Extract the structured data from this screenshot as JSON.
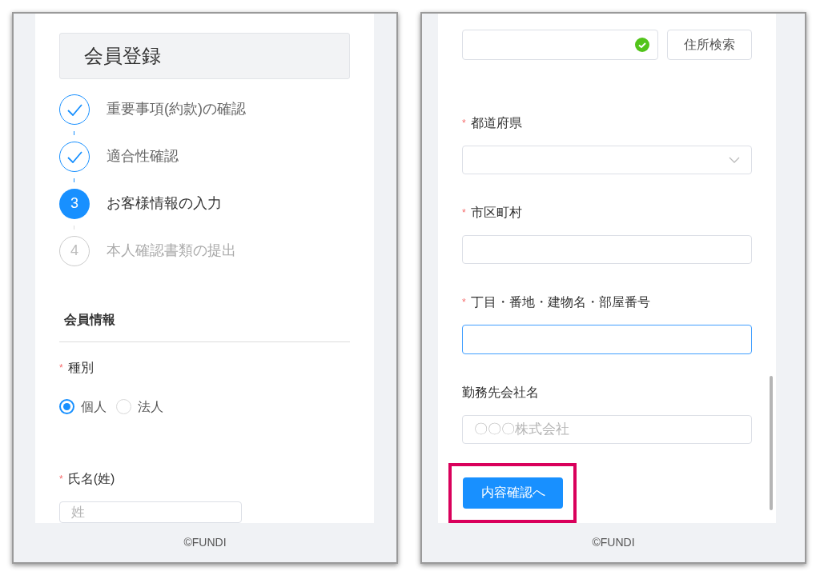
{
  "screens": [
    {
      "title": "会員登録",
      "steps": [
        {
          "label": "重要事項(約款)の確認",
          "kind": "done"
        },
        {
          "label": "適合性確認",
          "kind": "done"
        },
        {
          "number": "3",
          "label": "お客様情報の入力",
          "kind": "current"
        },
        {
          "number": "4",
          "label": "本人確認書類の提出",
          "kind": "pending"
        }
      ],
      "section_title": "会員情報",
      "fields": [
        {
          "kind": "radio",
          "label": "種別",
          "required_mark": "*",
          "options": [
            {
              "label": "個人",
              "selected": true
            },
            {
              "label": "法人",
              "selected": false
            }
          ]
        },
        {
          "kind": "text",
          "label": "氏名(姓)",
          "required_mark": "*",
          "placeholder": "姓",
          "short": true
        }
      ],
      "footer": "©FUNDI"
    },
    {
      "fields": [
        {
          "kind": "search",
          "valid": true,
          "button": "住所検索"
        },
        {
          "kind": "select",
          "label": "都道府県",
          "required_mark": "*"
        },
        {
          "kind": "text",
          "label": "市区町村",
          "required_mark": "*"
        },
        {
          "kind": "text",
          "label": "丁目・番地・建物名・部屋番号",
          "required_mark": "*",
          "focused": true
        },
        {
          "kind": "text",
          "label": "勤務先会社名",
          "placeholder": "〇〇〇株式会社"
        }
      ],
      "submit": {
        "label": "内容確認へ",
        "highlighted": true
      },
      "footer": "©FUNDI"
    }
  ]
}
